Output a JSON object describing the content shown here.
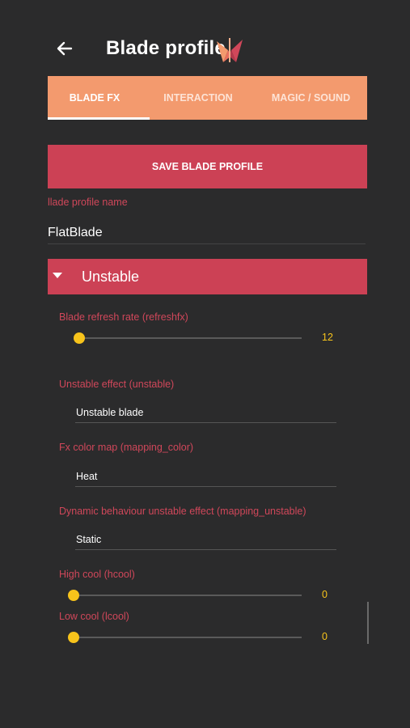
{
  "header": {
    "title": "Blade profile",
    "back_icon": "arrow-left-icon",
    "logo_icon": "blade-logo-icon"
  },
  "tabs": [
    {
      "label": "BLADE FX",
      "active": true
    },
    {
      "label": "INTERACTION",
      "active": false
    },
    {
      "label": "MAGIC / SOUND",
      "active": false
    }
  ],
  "save_button": {
    "label": "SAVE BLADE PROFILE"
  },
  "profile_name": {
    "label": "llade profile name",
    "value": "FlatBlade"
  },
  "section": {
    "title": "Unstable",
    "expanded": true
  },
  "refresh_rate": {
    "label": "Blade refresh rate (refreshfx)",
    "value": "12",
    "fraction": 0.0
  },
  "unstable_effect": {
    "label": "Unstable effect (unstable)",
    "value": "Unstable blade"
  },
  "color_map": {
    "label": "Fx color map (mapping_color)",
    "value": "Heat"
  },
  "dynamic_behaviour": {
    "label": "Dynamic behaviour unstable effect (mapping_unstable)",
    "value": "Static"
  },
  "high_cool": {
    "label": "High cool (hcool)",
    "value": "0",
    "fraction": 0.0
  },
  "low_cool": {
    "label": "Low cool (lcool)",
    "value": "0",
    "fraction": 0.0
  },
  "colors": {
    "background": "#2b2b2c",
    "tab_bar": "#f39a6e",
    "accent_red": "#cc4155",
    "label_red": "#d0475a",
    "slider_yellow": "#f7c31b"
  }
}
